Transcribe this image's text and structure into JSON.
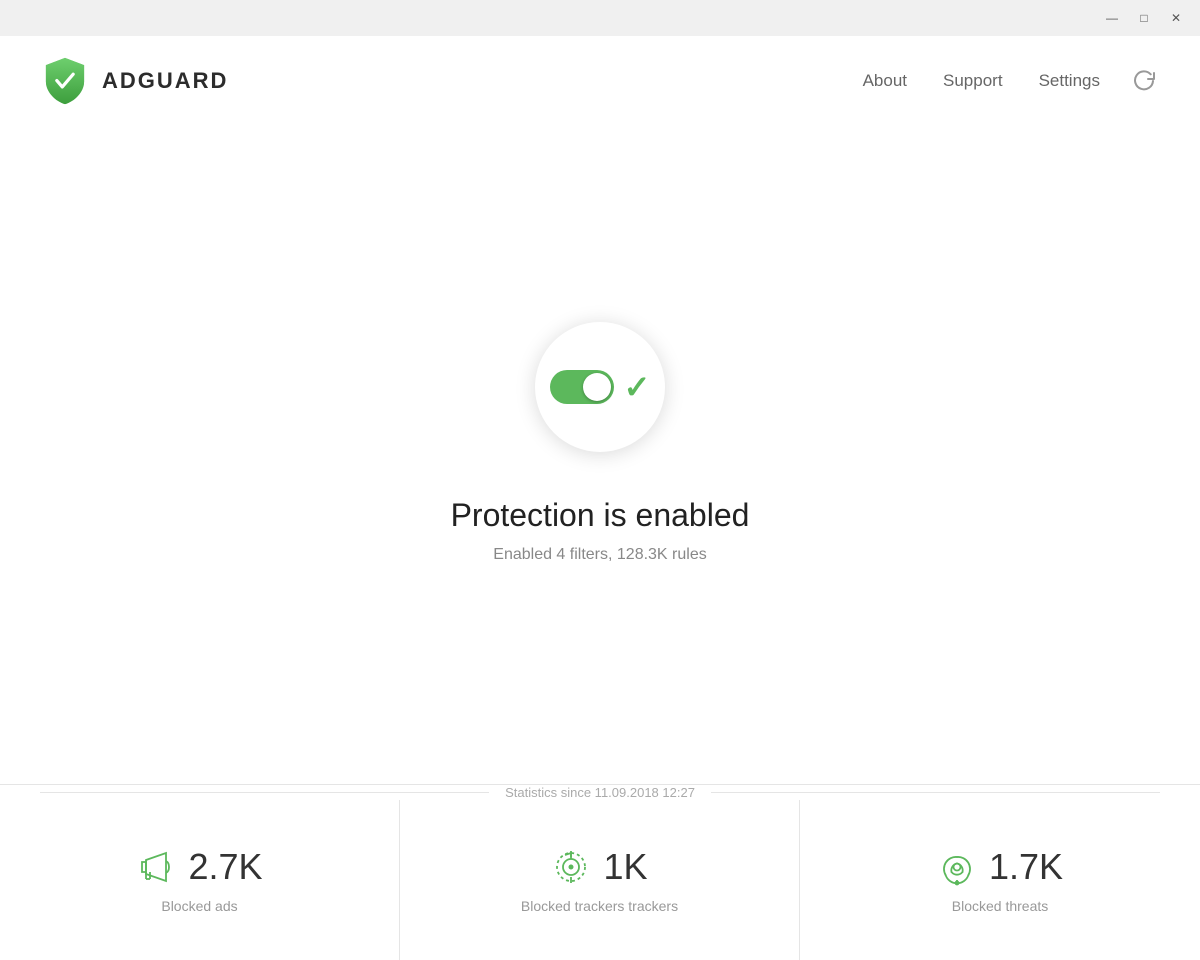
{
  "titlebar": {
    "minimize_label": "—",
    "restore_label": "□",
    "close_label": "✕"
  },
  "header": {
    "logo_text": "ADGUARD",
    "nav": {
      "about": "About",
      "support": "Support",
      "settings": "Settings"
    }
  },
  "protection": {
    "title": "Protection is enabled",
    "subtitle": "Enabled 4 filters, 128.3K rules"
  },
  "stats": {
    "since_label": "Statistics since 11.09.2018 12:27",
    "items": [
      {
        "value": "2.7K",
        "label": "Blocked ads",
        "icon": "megaphone"
      },
      {
        "value": "1K",
        "label": "Blocked trackers trackers",
        "icon": "target"
      },
      {
        "value": "1.7K",
        "label": "Blocked threats",
        "icon": "biohazard"
      }
    ]
  }
}
